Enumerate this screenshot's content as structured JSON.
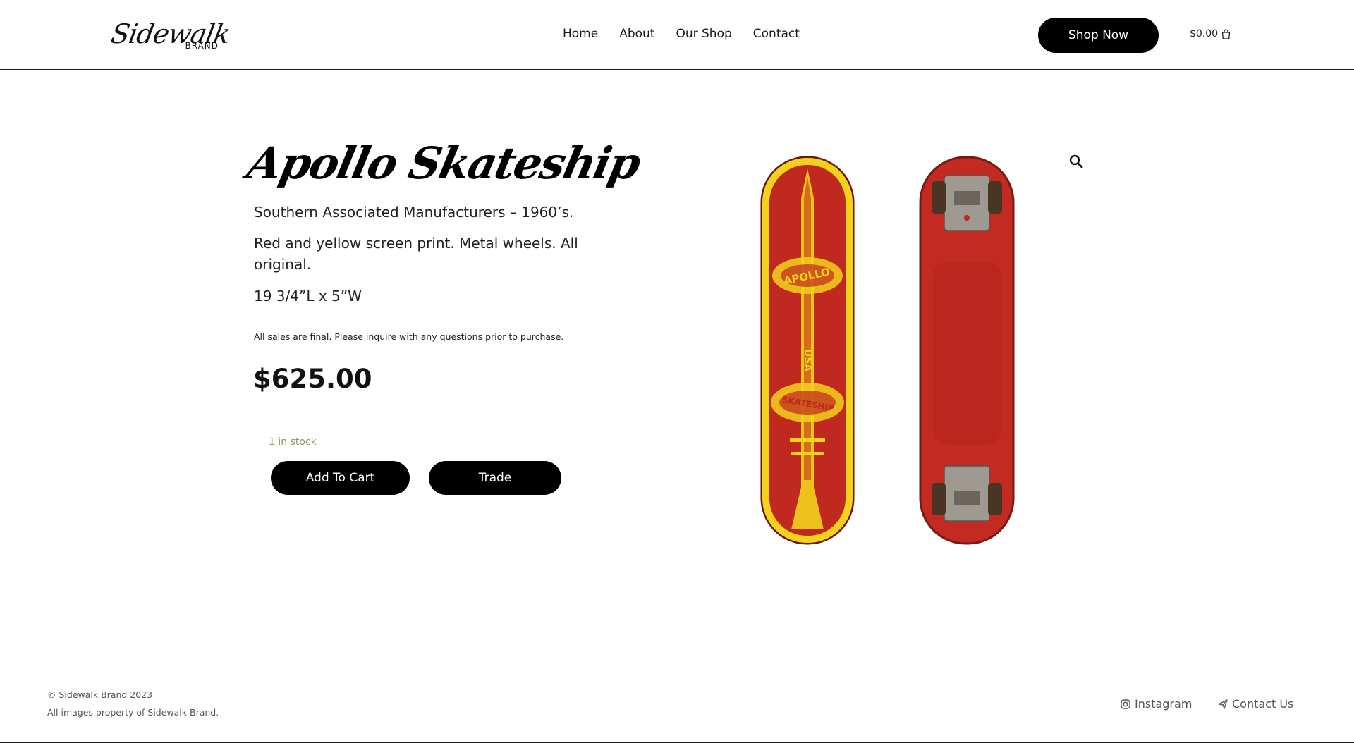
{
  "header": {
    "logo_script": "Sidewalk",
    "logo_sub": "BRAND",
    "nav": [
      "Home",
      "About",
      "Our Shop",
      "Contact"
    ],
    "cta_label": "Shop Now",
    "cart_total": "$0.00",
    "cart_icon": "shopping-bag-icon"
  },
  "product": {
    "title": "Apollo Skateship",
    "description": [
      "Southern Associated Manufacturers – 1960’s.",
      "Red and yellow screen print. Metal wheels. All original.",
      "19 3/4”L x 5”W"
    ],
    "note": "All sales are final. Please inquire with any questions prior to purchase.",
    "price": "$625.00",
    "stock": "1 in stock",
    "add_to_cart_label": "Add To Cart",
    "trade_label": "Trade",
    "zoom_icon": "magnifier-icon",
    "board_text": [
      "APOLLO",
      "USA",
      "SKATESHIP"
    ],
    "colors": {
      "deck": "#c0291f",
      "print": "#f2d21b",
      "button": "#000000",
      "stock": "#8b9a5b"
    }
  },
  "footer": {
    "copyright": "© Sidewalk Brand 2023",
    "rights": "All images property of Sidewalk Brand.",
    "links": [
      {
        "label": "Instagram",
        "icon": "instagram-icon"
      },
      {
        "label": "Contact Us",
        "icon": "paper-plane-icon"
      }
    ]
  }
}
